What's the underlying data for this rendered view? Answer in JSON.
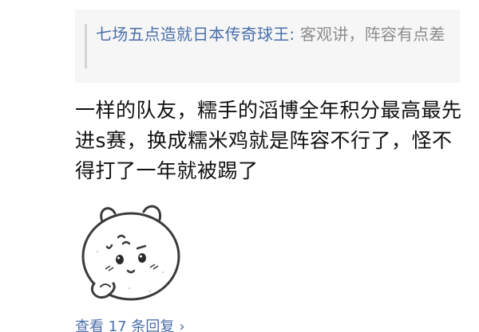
{
  "quote": {
    "author": "七场五点造就日本传奇球王:",
    "text": "客观讲，阵容有点差"
  },
  "comment": {
    "body": "一样的队友，糯手的滔博全年积分最高最先进s赛，换成糯米鸡就是阵容不行了，怪不得打了一年就被踢了"
  },
  "sticker": {
    "icon": "chiikawa-thinking-sticker"
  },
  "replies": {
    "label": "查看 17 条回复",
    "chevron": "›"
  },
  "colors": {
    "link": "#4b6fa8",
    "quote_bg": "#f6f6f6",
    "quote_text": "#8c8c8c",
    "body_text": "#111111"
  }
}
